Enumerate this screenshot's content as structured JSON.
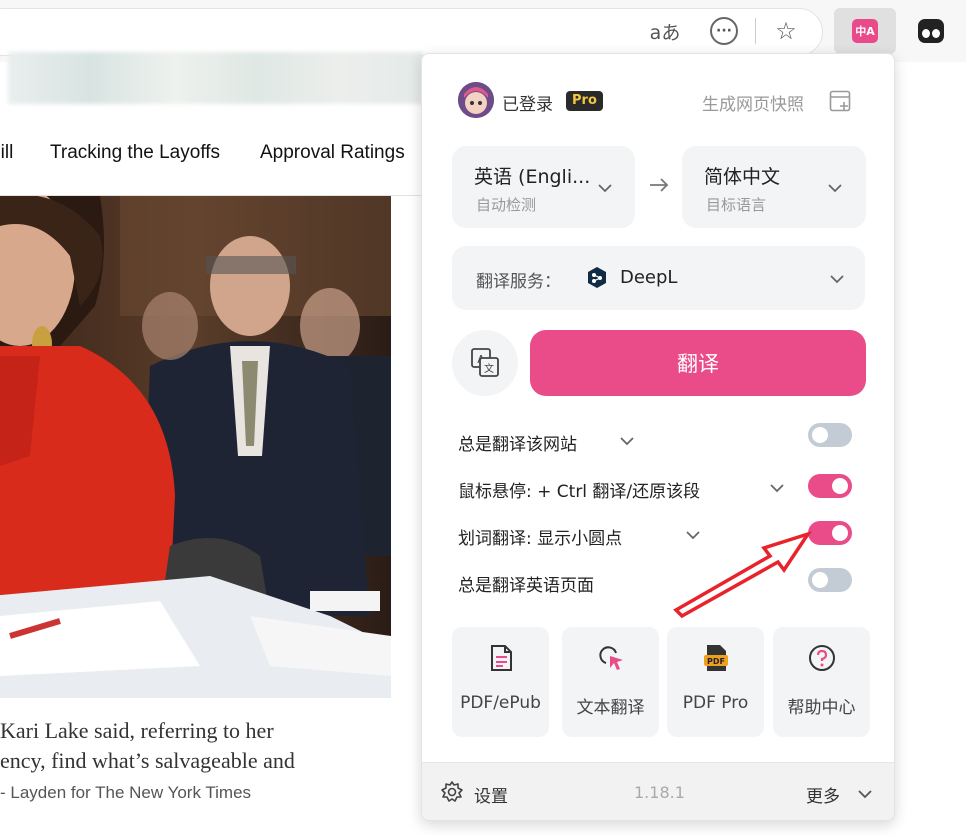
{
  "browser": {
    "read_aloud_label": "aあ",
    "more_label": "···",
    "favorite_label": "☆",
    "translator_ext_label": "中A"
  },
  "page": {
    "nav_links": [
      "Bill",
      "Tracking the Layoffs",
      "Approval Ratings"
    ],
    "caption_lines": [
      "Kari Lake said, referring to her",
      "ency, find what’s salvageable and"
    ],
    "photo_credit": "- Layden for The New York Times"
  },
  "popup": {
    "login_status": "已登录",
    "pro_badge": "Pro",
    "snapshot_label": "生成网页快照",
    "source_lang": {
      "name": "英语 (Engli...",
      "hint": "自动检测"
    },
    "target_lang": {
      "name": "简体中文",
      "hint": "目标语言"
    },
    "service": {
      "label": "翻译服务：",
      "name": "DeepL"
    },
    "translate_button": "翻译",
    "options": [
      {
        "label": "总是翻译该网站",
        "has_dropdown": true,
        "enabled": false
      },
      {
        "label": "鼠标悬停:  + Ctrl 翻译/还原该段",
        "has_dropdown": true,
        "enabled": true
      },
      {
        "label": "划词翻译:  显示小圆点",
        "has_dropdown": true,
        "enabled": true
      },
      {
        "label": "总是翻译英语页面",
        "has_dropdown": false,
        "enabled": false
      }
    ],
    "tiles": [
      {
        "label": "PDF/ePub",
        "icon": "document-icon"
      },
      {
        "label": "文本翻译",
        "icon": "cursor-translate-icon"
      },
      {
        "label": "PDF Pro",
        "icon": "pdf-pro-icon"
      },
      {
        "label": "帮助中心",
        "icon": "help-icon"
      }
    ],
    "footer": {
      "settings_label": "设置",
      "version": "1.18.1",
      "more_label": "更多"
    }
  },
  "colors": {
    "accent_pink": "#ea4c89",
    "toggle_off": "#c3cbd4",
    "annotation_arrow": "#e8232c"
  }
}
